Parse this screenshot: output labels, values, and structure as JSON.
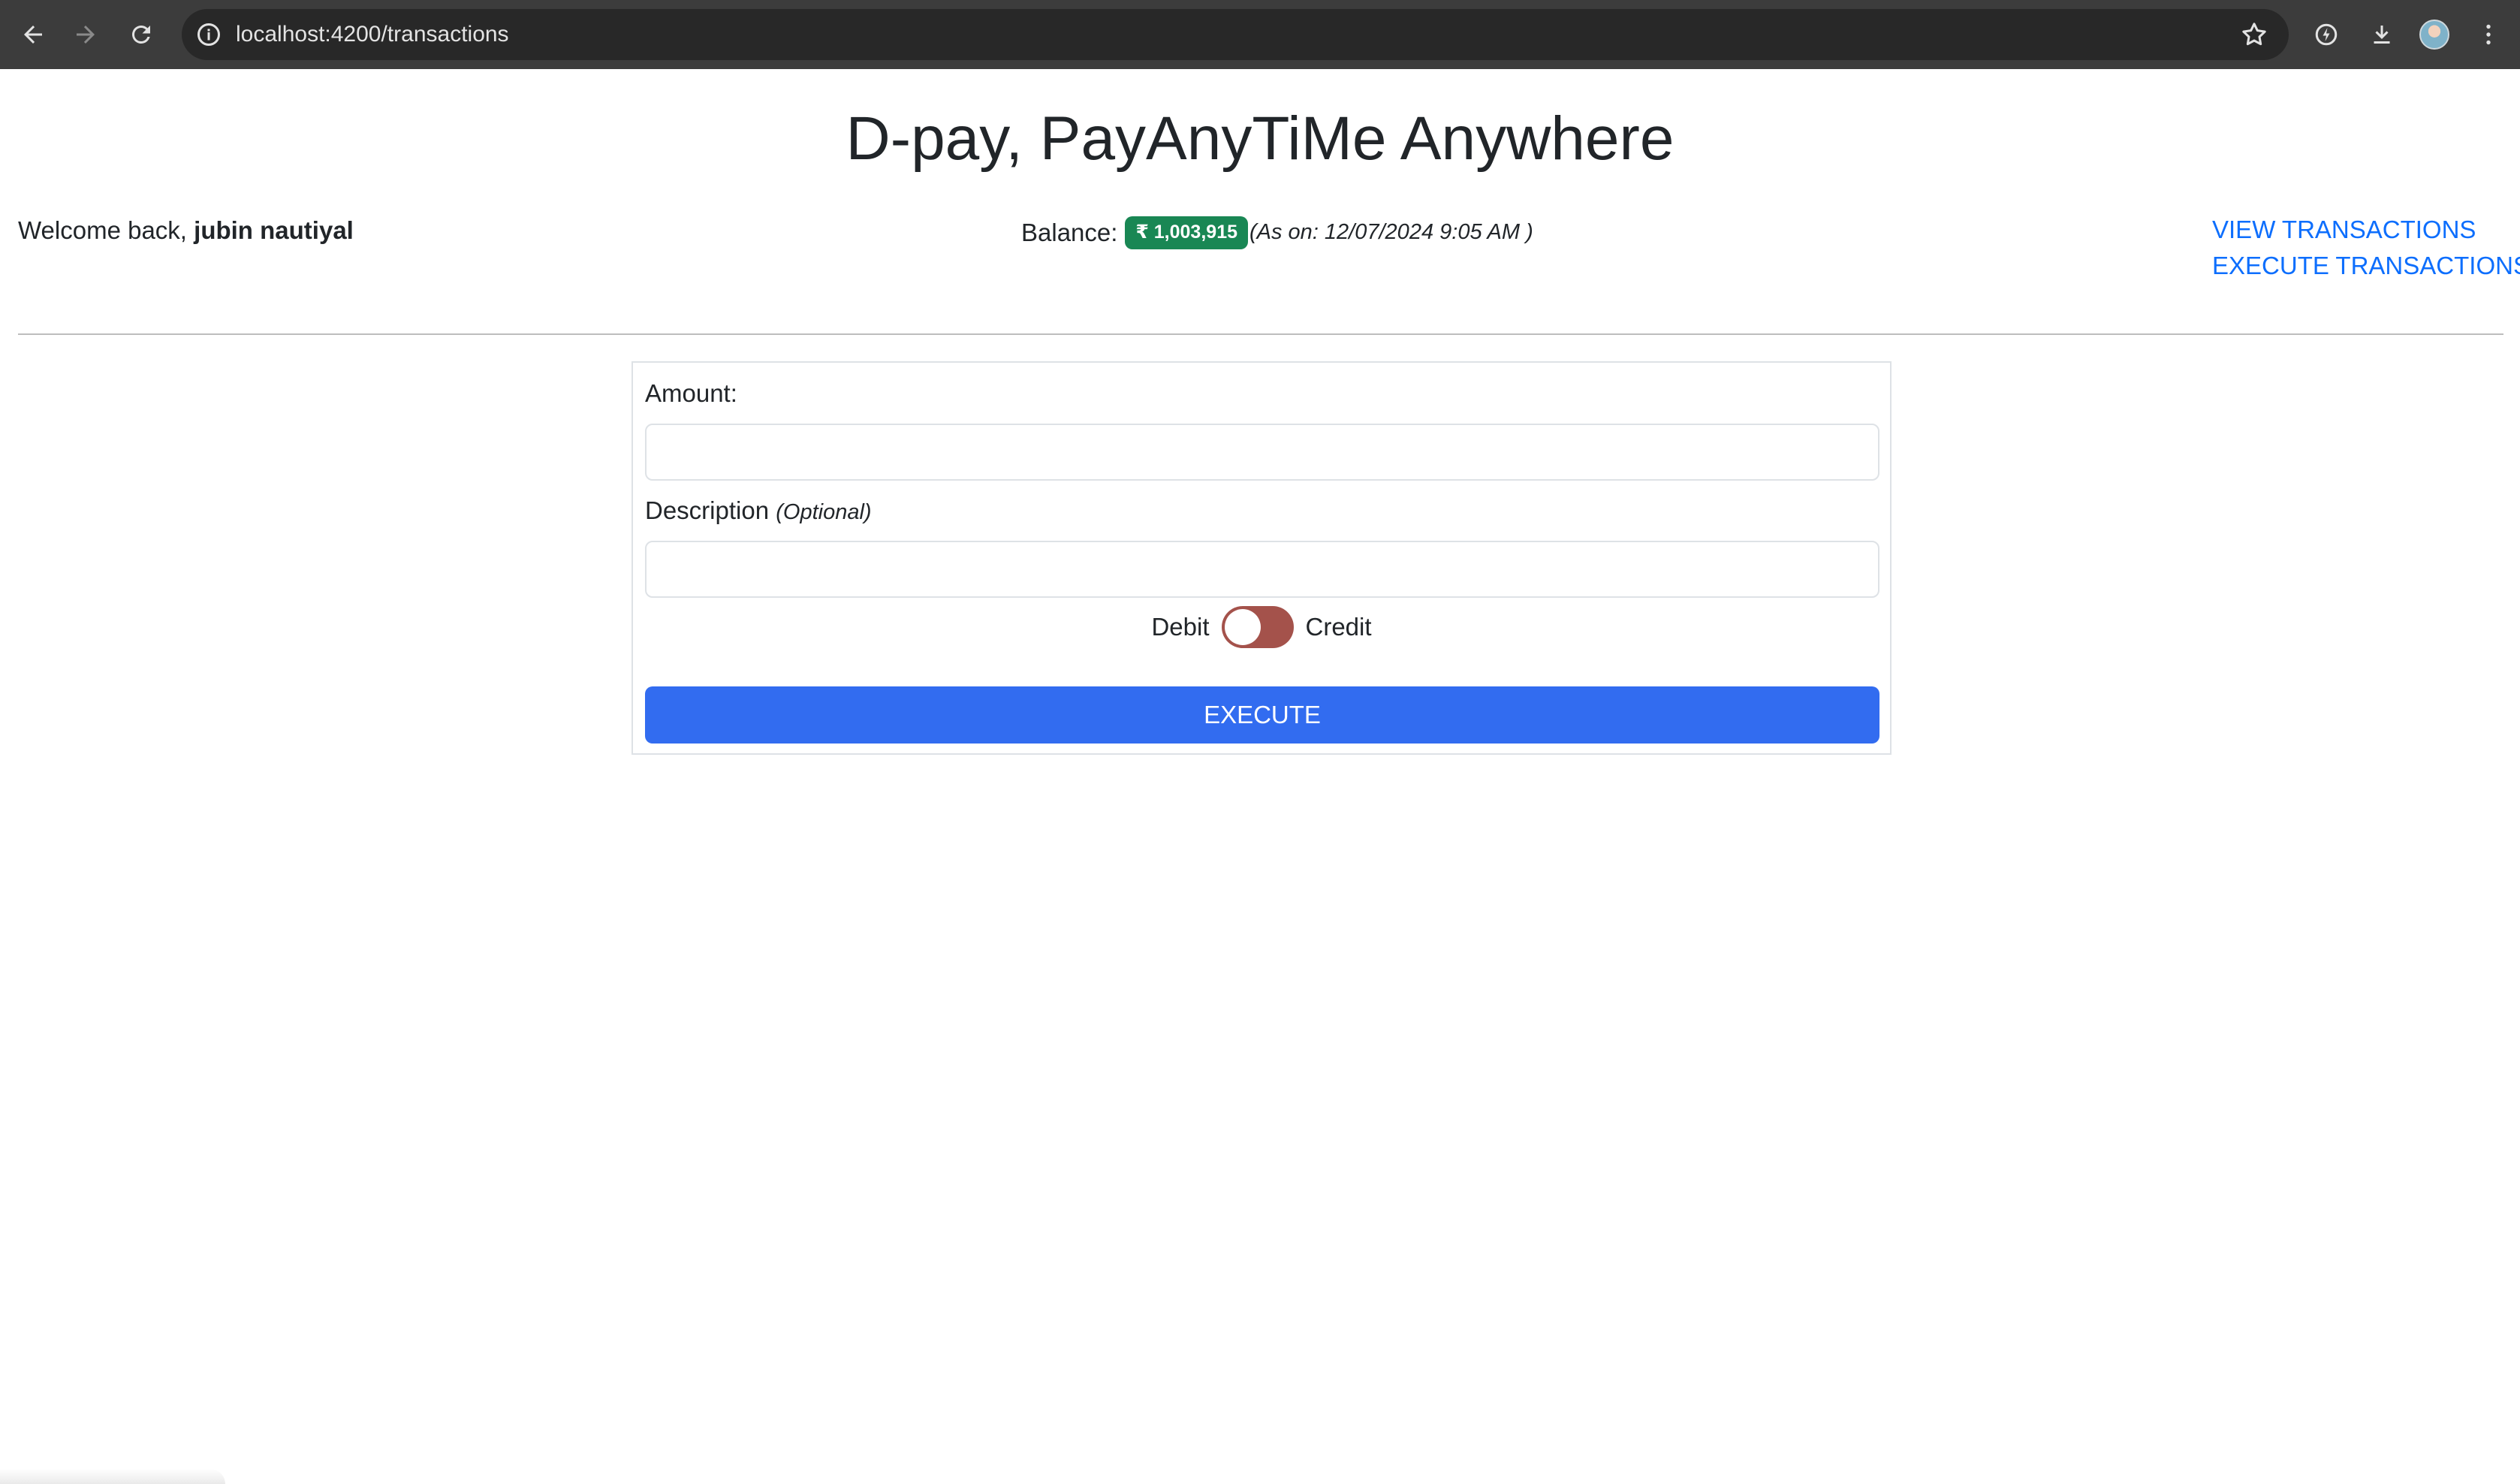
{
  "browser": {
    "url": "localhost:4200/transactions",
    "icons": [
      "back-arrow-icon",
      "forward-arrow-icon",
      "reload-icon",
      "site-info-icon",
      "bookmark-star-icon",
      "extension-icon",
      "download-icon",
      "profile-avatar",
      "more-menu-icon"
    ]
  },
  "page": {
    "title": "D-pay, PayAnyTiMe Anywhere"
  },
  "header": {
    "welcome_prefix": "Welcome back, ",
    "user_name": "jubin nautiyal",
    "balance_label": "Balance: ",
    "balance_value": "₹ 1,003,915",
    "as_on": "(As on: 12/07/2024 9:05 AM )",
    "nav_links": [
      "VIEW TRANSACTIONS",
      "EXECUTE TRANSACTIONS"
    ]
  },
  "form": {
    "amount_label": "Amount:",
    "amount_value": "",
    "description_label": "Description",
    "description_optional": "(Optional)",
    "description_value": "",
    "toggle_left_label": "Debit",
    "toggle_right_label": "Credit",
    "toggle_state": "Debit",
    "execute_label": "EXECUTE"
  },
  "colors": {
    "chrome_bg": "#3c3c3c",
    "omnibox_bg": "#282828",
    "link": "#0d6efd",
    "badge": "#198754",
    "toggle": "#a4524b",
    "execute_button": "#326cf0"
  }
}
